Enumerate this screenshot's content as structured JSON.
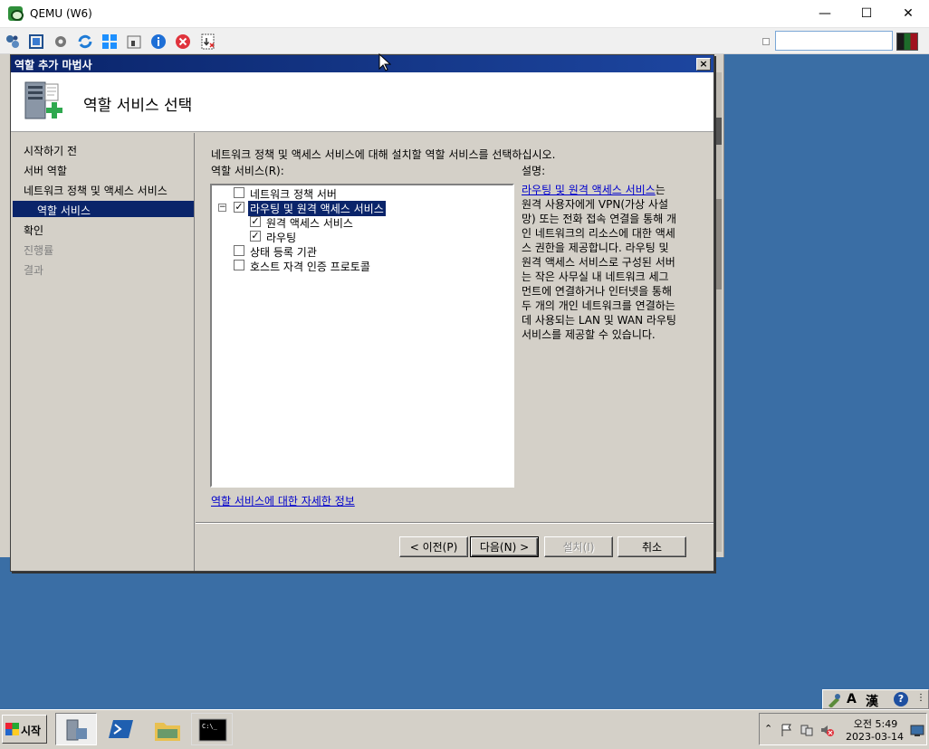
{
  "qemu": {
    "title": "QEMU (W6)",
    "controls": {
      "minimize": "—",
      "maximize": "☐",
      "close": "✕"
    },
    "toolbar_icons": [
      "network-icon",
      "fullscreen-icon",
      "settings-icon",
      "refresh-icon",
      "windows-icon",
      "usb-icon",
      "info-icon",
      "stop-icon",
      "screenshot-icon"
    ],
    "search_value": ""
  },
  "wizard": {
    "title": "역할 추가 마법사",
    "close_glyph": "×",
    "header_title": "역할 서비스 선택",
    "nav": [
      {
        "label": "시작하기 전",
        "state": "normal"
      },
      {
        "label": "서버 역할",
        "state": "normal"
      },
      {
        "label": "네트워크 정책 및 액세스 서비스",
        "state": "normal"
      },
      {
        "label": "역할 서비스",
        "state": "selected"
      },
      {
        "label": "확인",
        "state": "normal"
      },
      {
        "label": "진행률",
        "state": "disabled"
      },
      {
        "label": "결과",
        "state": "disabled"
      }
    ],
    "intro": "네트워크 정책 및 액세스 서비스에 대해 설치할 역할 서비스를 선택하십시오.",
    "list_label": "역할 서비스(R):",
    "desc_label": "설명:",
    "roles": [
      {
        "label": "네트워크 정책 서버",
        "checked": false,
        "level": 0,
        "expander": ""
      },
      {
        "label": "라우팅 및 원격 액세스 서비스",
        "checked": true,
        "level": 0,
        "expander": "−",
        "selected": true
      },
      {
        "label": "원격 액세스 서비스",
        "checked": true,
        "level": 1,
        "expander": ""
      },
      {
        "label": "라우팅",
        "checked": true,
        "level": 1,
        "expander": ""
      },
      {
        "label": "상태 등록 기관",
        "checked": false,
        "level": 0,
        "expander": ""
      },
      {
        "label": "호스트 자격 인증 프로토콜",
        "checked": false,
        "level": 0,
        "expander": ""
      }
    ],
    "description_link": "라우팅 및 원격 액세스 서비스",
    "description_lines": [
      "는",
      "원격 사용자에게 VPN(가상 사설",
      "망) 또는 전화 접속 연결을 통해 개",
      "인 네트워크의 리소스에 대한 액세",
      "스 권한을 제공합니다. 라우팅 및",
      "원격 액세스 서비스로 구성된 서버",
      "는 작은 사무실 내 네트워크 세그",
      "먼트에 연결하거나 인터넷을 통해",
      "두 개의 개인 네트워크를 연결하는",
      "데 사용되는 LAN 및 WAN 라우팅",
      "서비스를 제공할 수 있습니다."
    ],
    "more_info_link": "역할 서비스에 대한 자세한 정보",
    "buttons": {
      "prev": "< 이전(P)",
      "next": "다음(N) >",
      "install": "설치(I)",
      "cancel": "취소"
    }
  },
  "langbar": {
    "ime_mode": "A",
    "hanja": "漢",
    "help": "?"
  },
  "taskbar": {
    "start_label": "시작",
    "apps": [
      "server-manager",
      "powershell",
      "explorer",
      "cmd"
    ],
    "clock_time": "오전 5:49",
    "clock_date": "2023-03-14"
  },
  "colors": {
    "desktop": "#3a6ea5",
    "titlebar": "#0a246a",
    "dialog": "#d4d0c8",
    "link": "#0000cc"
  }
}
